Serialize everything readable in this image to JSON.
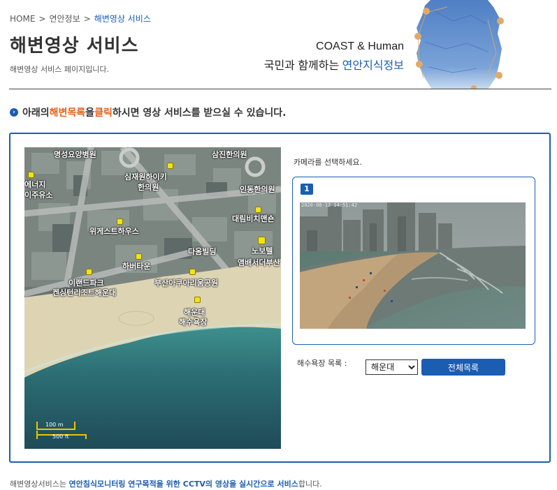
{
  "breadcrumb": {
    "home": "HOME",
    "parent": "연안정보",
    "current": "해변영상 서비스",
    "separator": ">"
  },
  "page": {
    "title": "해변영상 서비스",
    "subtitle": "해변영상 서비스 페이지입니다."
  },
  "brand": {
    "english": "COAST & Human",
    "korean_prefix": "국민과 함께하는 ",
    "korean_highlight": "연안지식정보"
  },
  "notice": {
    "prefix": "아래의 ",
    "highlight1": "해변목록",
    "middle": "을 ",
    "highlight2": "클릭",
    "suffix": "하시면 영상 서비스를 받으실 수 있습니다."
  },
  "map": {
    "labels": {
      "l1": "명성요양병원",
      "l2": "삼진한의원",
      "l3": "에너지",
      "l4": "이주유소",
      "l5": "심재원하이키",
      "l6": "한의원",
      "l7": "인동한의원",
      "l8": "대림비치맨숀",
      "l9": "위게스트하우스",
      "l10": "노보텔",
      "l11": "다옴빌딩",
      "l12": "앰배서더부산",
      "l13": "하버타운",
      "l14": "이랜드파크",
      "l15": "켄싱턴리조트해운대",
      "l16": "부산아쿠아리움공원",
      "l17": "해운대",
      "l18": "해수욕장"
    },
    "scale": {
      "metric": "100 m",
      "imperial": "500 ft"
    }
  },
  "camera": {
    "prompt": "카메라를 선택하세요.",
    "number": "1",
    "timestamp": "2020-08-12 14:51:42"
  },
  "beach": {
    "list_label": "해수욕장 목록 :",
    "selected": "해운대",
    "all_button": "전체목록"
  },
  "footer": {
    "prefix": "해변영상서비스는 ",
    "highlight": "연안침식모니터링 연구목적을 위한 CCTV의 영상을 실시간으로 서비스",
    "suffix": "합니다."
  },
  "colors": {
    "accent": "#1a5db3",
    "orange": "#e8601c",
    "marker": "#f2e21a"
  }
}
